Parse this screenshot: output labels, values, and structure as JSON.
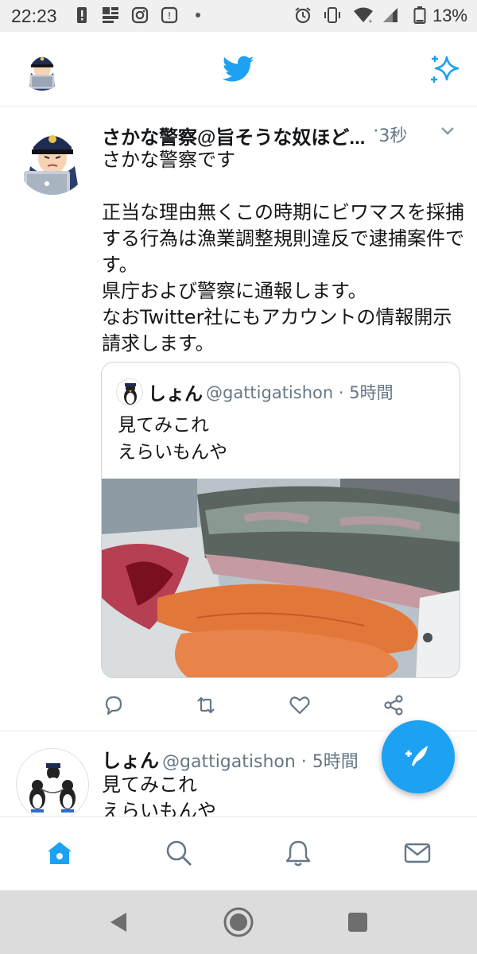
{
  "status_bar": {
    "time": "22:23",
    "battery_percent": "13%",
    "icons": [
      "alert-icon",
      "news-icon",
      "instagram-icon",
      "app-icon",
      "dot-icon",
      "alarm-icon",
      "vibrate-icon",
      "wifi-icon",
      "signal-icon",
      "battery-icon"
    ]
  },
  "app_bar": {
    "icons": [
      "profile-avatar",
      "twitter-bird-icon",
      "sparkle-icon"
    ],
    "accent_color": "#1da1f2"
  },
  "tweet": {
    "name": "さかな警察@旨そうな奴ほど...",
    "separator": "·",
    "time": "3秒",
    "text": "さかな警察です\n\n正当な理由無くこの時期にビワマスを採捕する行為は漁業調整規則違反で逮捕案件です。\n県庁および警察に通報します。\nなおTwitter社にもアカウントの情報開示請求します。",
    "quote": {
      "name": "しょん",
      "handle": "@gattigatishon · 5時間",
      "text": "見てみこれ\nえらいもんや",
      "image": "fish-with-roe-photo"
    },
    "actions": [
      "reply-icon",
      "retweet-icon",
      "like-icon",
      "share-icon"
    ]
  },
  "tweet2": {
    "name": "しょん",
    "handle": "@gattigatishon · 5時間",
    "text": "見てみこれ\nえらいもんや"
  },
  "compose_button": {
    "icon": "compose-feather-icon"
  },
  "bottom_nav": {
    "items": [
      "home-icon",
      "search-icon",
      "notifications-icon",
      "messages-icon"
    ],
    "active": "home-icon"
  },
  "system_nav": [
    "back-icon",
    "home-circle-icon",
    "recents-icon"
  ]
}
